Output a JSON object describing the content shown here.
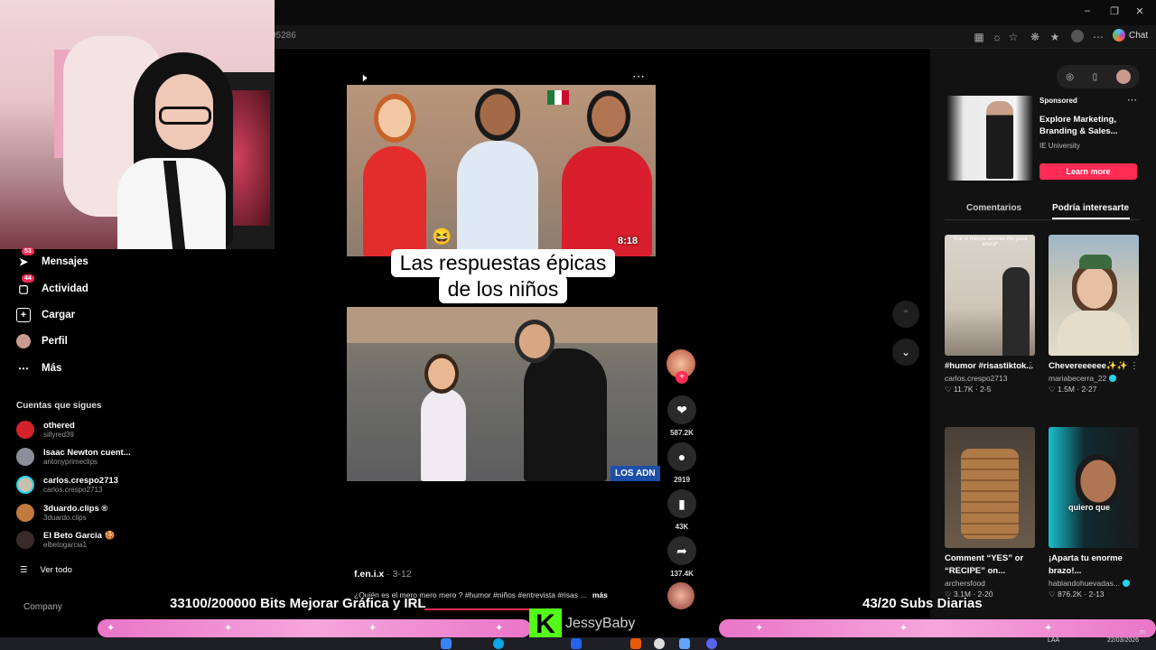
{
  "browser": {
    "url_fragment": "95286",
    "chat_label": "Chat"
  },
  "sidebar": {
    "items": [
      {
        "label": "Mensajes",
        "icon": "send-icon",
        "badge": "53"
      },
      {
        "label": "Actividad",
        "icon": "inbox-icon",
        "badge": "44"
      },
      {
        "label": "Cargar",
        "icon": "upload-icon",
        "badge": ""
      },
      {
        "label": "Perfil",
        "icon": "avatar-icon",
        "badge": ""
      },
      {
        "label": "Más",
        "icon": "more-icon",
        "badge": ""
      }
    ],
    "following_title": "Cuentas que sigues",
    "accounts": [
      {
        "name": "othered",
        "handle": "sillyred39",
        "color": "#d2232a"
      },
      {
        "name": "Isaac Newton cuent...",
        "handle": "antonyprimeclips",
        "color": "#8a8f99"
      },
      {
        "name": "carlos.crespo2713",
        "handle": "carlos.crespo2713",
        "color": "#c9c0b0"
      },
      {
        "name": "3duardo.clips ®",
        "handle": "3duardo.clips",
        "color": "#c07a3e"
      },
      {
        "name": "El Beto Garcia 🍪",
        "handle": "elbetogarcia1",
        "color": "#3a2a2a"
      }
    ],
    "see_all": "Ver todo",
    "company": "Company"
  },
  "video": {
    "caption_line1": "Las respuestas épicas",
    "caption_line2": "de los niños",
    "duration": "8:18",
    "watermark": "LOS ADN",
    "author": "f.en.i.x",
    "date": "· 3-12",
    "description": "¿Quién es el mero mero mero ? #humor #niños #entrevista #risas ...",
    "more_label": "más"
  },
  "actions": {
    "likes": "587.2K",
    "comments": "2919",
    "saves": "43K",
    "shares": "137.4K"
  },
  "right_panel": {
    "ad": {
      "sponsored": "Sponsored",
      "title": "Explore Marketing, Branding & Sales...",
      "brand": "IE University",
      "cta": "Learn more"
    },
    "tabs": [
      "Comentarios",
      "Podría interesarte"
    ],
    "cards": [
      {
        "title": "#humor #risastiktok...",
        "user": "carlos.crespo2713",
        "verified": false,
        "likes": "11.7K",
        "date": "2-5",
        "thumb_text": "*Por si menos animes me puse ahora*"
      },
      {
        "title": "Chevereeeeee✨✨",
        "user": "mariabecerra_22",
        "verified": true,
        "likes": "1.5M",
        "date": "2-27",
        "thumb_text": ""
      },
      {
        "title": "Comment “YES” or “RECIPE” on...",
        "user": "archersfood",
        "verified": false,
        "likes": "3.1M",
        "date": "2-20",
        "thumb_text": ""
      },
      {
        "title": "¡Aparta tu enorme brazo!...",
        "user": "hablandohuevadas...",
        "verified": true,
        "likes": "876.2K",
        "date": "2-13",
        "thumb_text": "quiero que"
      }
    ]
  },
  "overlay": {
    "bits_goal": "33100/200000 Bits Mejorar Gráfica y IRL",
    "subs_goal": "43/20 Subs Diarias",
    "streamer": "JessyBaby"
  },
  "taskbar": {
    "lang": "LAA",
    "date": "22/03/2026",
    "time_suffix": "m."
  }
}
